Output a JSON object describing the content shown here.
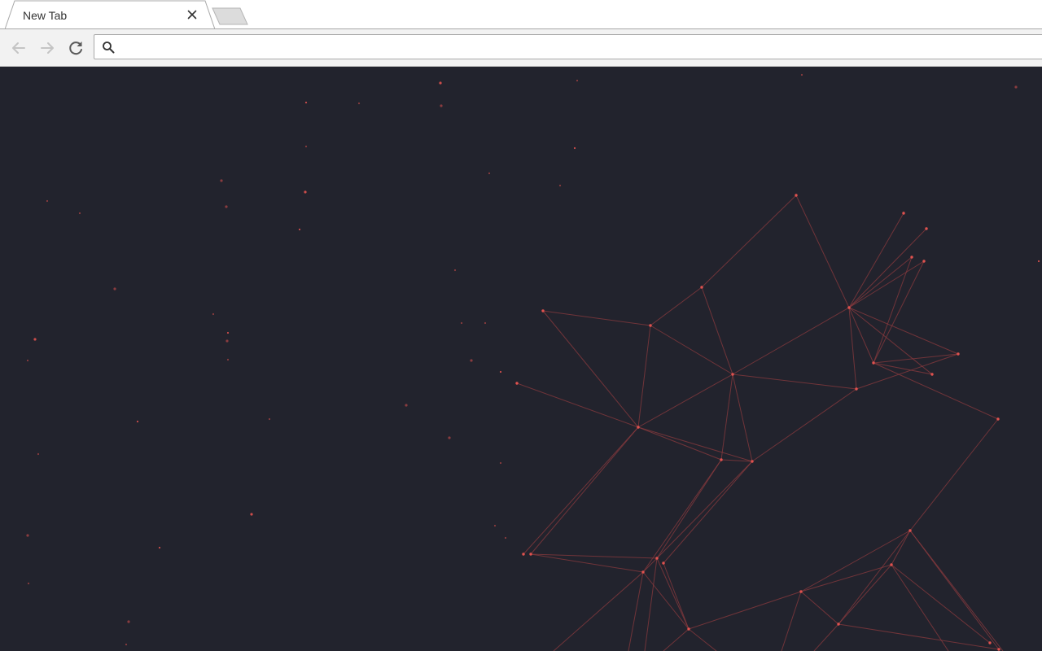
{
  "tab": {
    "title": "New Tab"
  },
  "omnibox": {
    "value": "",
    "placeholder": ""
  },
  "icons": {
    "back": "back-arrow-icon",
    "forward": "forward-arrow-icon",
    "reload": "reload-icon",
    "search": "search-icon",
    "close": "close-icon"
  },
  "colors": {
    "page_background": "#22232d",
    "particle": "#e0524f",
    "network_line": "#8a3a3e",
    "toolbar": "#f2f2f2"
  }
}
